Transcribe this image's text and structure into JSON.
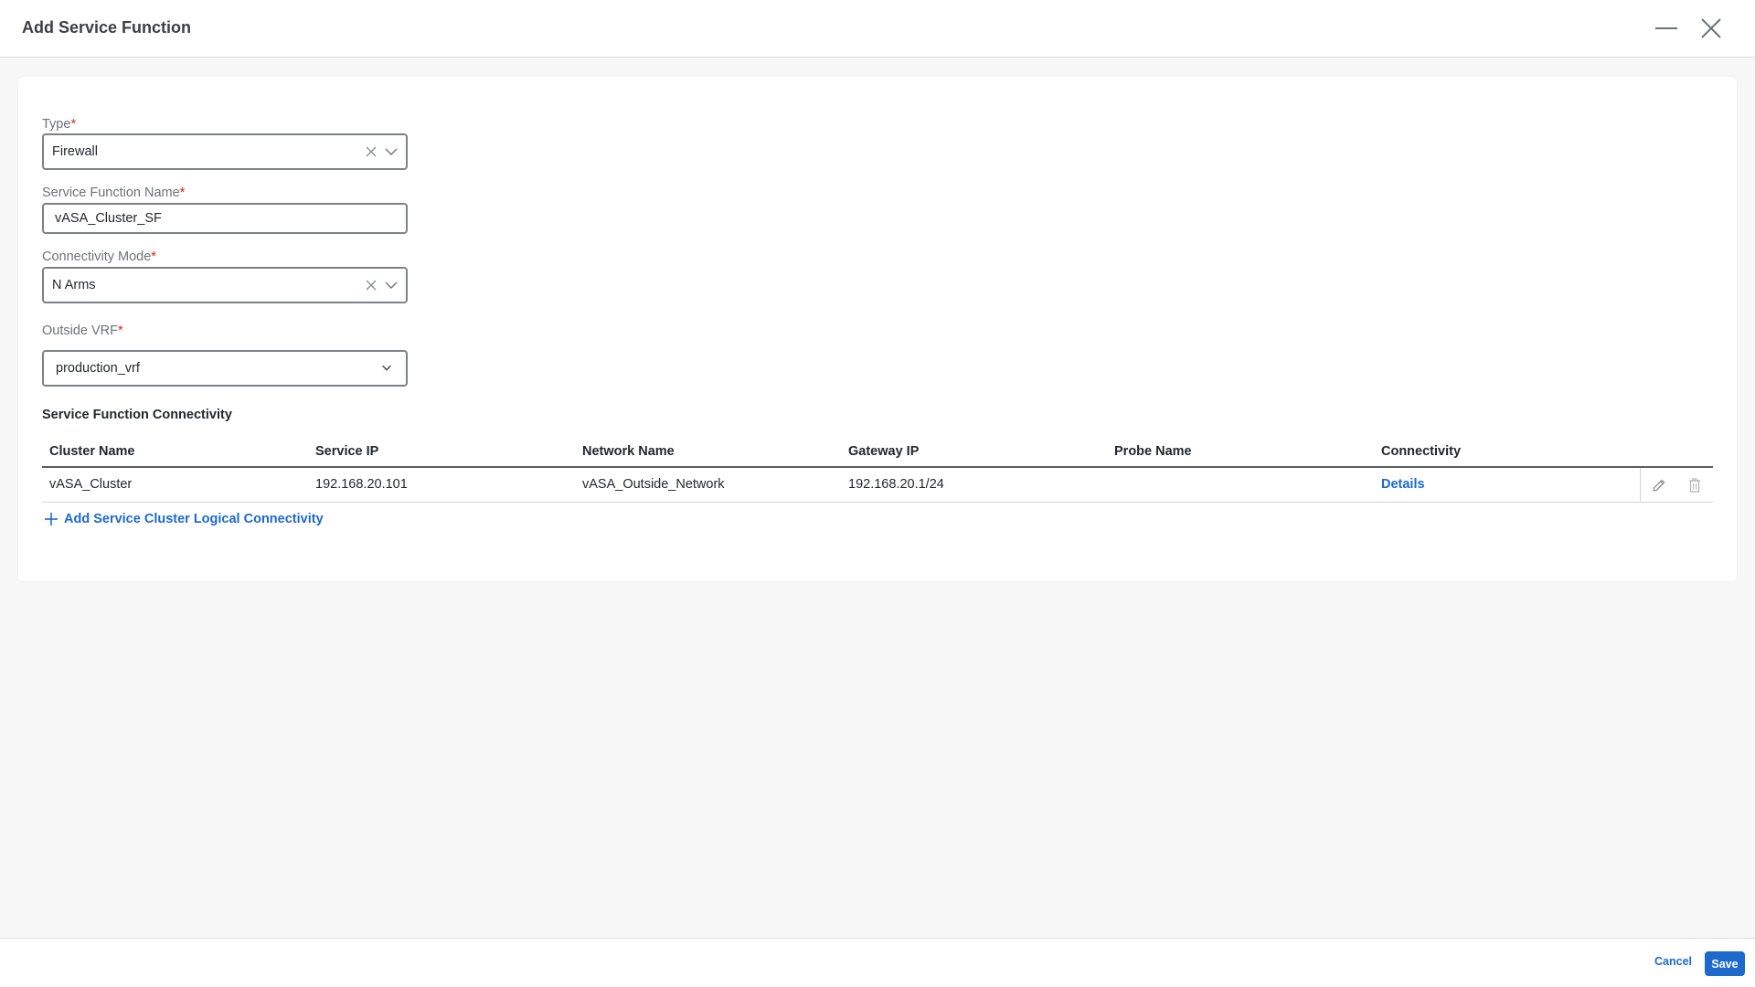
{
  "dialog": {
    "title": "Add Service Function"
  },
  "form": {
    "type": {
      "label": "Type",
      "required_mark": "*",
      "value": "Firewall"
    },
    "name": {
      "label": "Service Function Name",
      "required_mark": "*",
      "value": "vASA_Cluster_SF"
    },
    "connectivity_mode": {
      "label": "Connectivity Mode",
      "required_mark": "*",
      "value": "N Arms"
    },
    "outside_vrf": {
      "label": "Outside VRF",
      "required_mark": "*",
      "value": "production_vrf"
    }
  },
  "connectivity": {
    "section_title": "Service Function Connectivity",
    "columns": [
      "Cluster Name",
      "Service IP",
      "Network Name",
      "Gateway IP",
      "Probe Name",
      "Connectivity"
    ],
    "rows": [
      {
        "cluster_name": "vASA_Cluster",
        "service_ip": "192.168.20.101",
        "network_name": "vASA_Outside_Network",
        "gateway_ip": "192.168.20.1/24",
        "probe_name": "",
        "connectivity": "Details"
      }
    ],
    "add_label": "Add Service Cluster Logical Connectivity"
  },
  "footer": {
    "cancel_label": "Cancel",
    "save_label": "Save"
  },
  "icons": {
    "minimize": "minimize-icon",
    "close": "close-icon",
    "clear": "clear-icon",
    "chevron": "chevron-down-icon",
    "edit": "pencil-icon",
    "delete": "trash-icon",
    "add": "plus-icon"
  },
  "colors": {
    "accent": "#1d69cc",
    "required": "#e2231a"
  }
}
